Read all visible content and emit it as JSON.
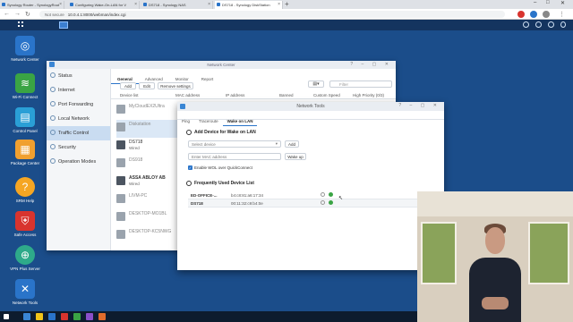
{
  "browser": {
    "tabs": [
      {
        "label": "Synology Router - SynologyRout",
        "active": false
      },
      {
        "label": "Configuring Wake-On-LAN for V",
        "active": false
      },
      {
        "label": "DS718 - Synology NAS",
        "active": false
      },
      {
        "label": "DS718 - Synology DiskStation",
        "active": true
      }
    ],
    "not_secure": "Not secure",
    "url": "10.0.4.1:8000/webman/index.cgi"
  },
  "desktop_icons": [
    {
      "label": "Network Center",
      "icon": "globe-icon",
      "color": "#2a74c9"
    },
    {
      "label": "Wi-Fi Connect",
      "icon": "wifi-icon",
      "color": "#3aa444"
    },
    {
      "label": "Control Panel",
      "icon": "control-panel-icon",
      "color": "#2a9fd6"
    },
    {
      "label": "Package Center",
      "icon": "package-icon",
      "color": "#f0a030"
    },
    {
      "label": "SRM Help",
      "icon": "help-icon",
      "color": "#f5a623"
    },
    {
      "label": "Safe Access",
      "icon": "shield-icon",
      "color": "#d8342e"
    },
    {
      "label": "VPN Plus Server",
      "icon": "vpn-icon",
      "color": "#2eaa8a"
    },
    {
      "label": "Network Tools",
      "icon": "tools-icon",
      "color": "#2a74c9"
    }
  ],
  "network_center": {
    "title": "Network Center",
    "sidebar": [
      "Status",
      "Internet",
      "Port Forwarding",
      "Local Network",
      "Traffic Control",
      "Security",
      "Operation Modes"
    ],
    "selected_sidebar": "Traffic Control",
    "tabs": [
      "General",
      "Advanced",
      "Monitor",
      "Report"
    ],
    "toolbar": {
      "add": "Add",
      "edit": "Edit",
      "remove": "Remove settings",
      "filter": "Filter"
    },
    "columns": [
      "Device list",
      "MAC address",
      "IP address",
      "Banned",
      "Custom Speed",
      "High Priority (0/3)"
    ],
    "devices": [
      {
        "name": "MyCloudEX2Ultra",
        "sub": "",
        "dim": true
      },
      {
        "name": "Diskstation",
        "sub": "",
        "dim": true
      },
      {
        "name": "DS718",
        "sub": "Wired",
        "dim": false
      },
      {
        "name": "DS918",
        "sub": "",
        "dim": true
      },
      {
        "name": "ASSA ABLOY AB",
        "sub": "Wired",
        "dim": false
      },
      {
        "name": "LIVM-PC",
        "sub": "",
        "dim": true
      },
      {
        "name": "DESKTOP-MO1BL",
        "sub": "",
        "dim": true
      },
      {
        "name": "DESKTOP-KC5NWG",
        "sub": "",
        "dim": true
      }
    ]
  },
  "network_tools": {
    "title": "Network Tools",
    "tabs": [
      "Ping",
      "Traceroute",
      "Wake on LAN"
    ],
    "active_tab": "Wake on LAN",
    "add_section": "Add Device for Wake on LAN",
    "select_device_placeholder": "Select device",
    "add_button": "Add",
    "mac_placeholder": "Enter MAC address",
    "wake_button": "Wake up",
    "enable_wol": "Enable WOL over QuickConnect",
    "frequent_section": "Frequently Used Device List",
    "frequent_devices": [
      {
        "name": "ED-OFFICE-...",
        "mac": "b4:c8:81:a6:17:34"
      },
      {
        "name": "DS718",
        "mac": "00:11:32:c9:b4:0e"
      }
    ]
  }
}
